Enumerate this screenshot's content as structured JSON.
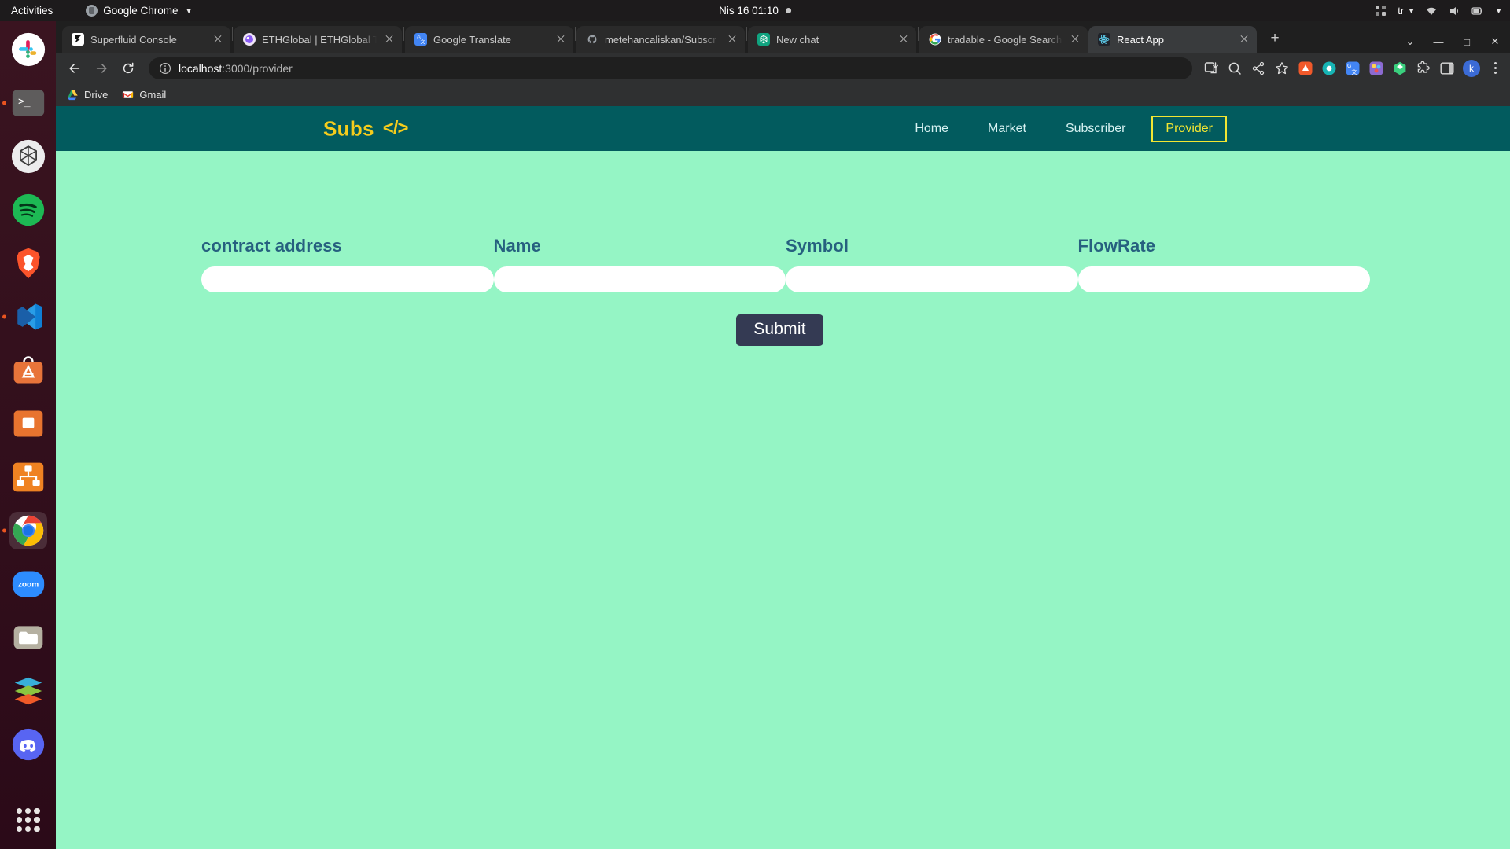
{
  "desktop": {
    "activities_label": "Activities",
    "active_app": "Google Chrome",
    "clock": "Nis 16  01:10",
    "keyboard_layout": "tr"
  },
  "dock": {
    "items": [
      {
        "name": "slack",
        "label": "Slack",
        "running": false
      },
      {
        "name": "terminal",
        "label": "Terminal",
        "running": true
      },
      {
        "name": "chatgpt",
        "label": "ChatGPT",
        "running": false
      },
      {
        "name": "spotify",
        "label": "Spotify",
        "running": false
      },
      {
        "name": "brave",
        "label": "Brave Browser",
        "running": false
      },
      {
        "name": "vscode",
        "label": "Visual Studio Code",
        "running": true
      },
      {
        "name": "ubuntu-software",
        "label": "Ubuntu Software",
        "running": false
      },
      {
        "name": "gimp",
        "label": "GIMP",
        "running": false
      },
      {
        "name": "remmina",
        "label": "Remmina",
        "running": false
      },
      {
        "name": "google-chrome",
        "label": "Google Chrome",
        "running": true
      },
      {
        "name": "zoom",
        "label": "Zoom",
        "running": false
      },
      {
        "name": "files",
        "label": "Files",
        "running": false
      },
      {
        "name": "layers",
        "label": "Layers",
        "running": false
      },
      {
        "name": "discord",
        "label": "Discord",
        "running": false
      }
    ],
    "show_apps_label": "Show Applications"
  },
  "browser": {
    "tabs": [
      {
        "title": "Superfluid Console",
        "favicon": "superfluid-icon",
        "active": false
      },
      {
        "title": "ETHGlobal | ETHGlobal T",
        "favicon": "ethglobal-icon",
        "active": false
      },
      {
        "title": "Google Translate",
        "favicon": "google-translate-icon",
        "active": false
      },
      {
        "title": "metehancaliskan/Subscr",
        "favicon": "github-icon",
        "active": false
      },
      {
        "title": "New chat",
        "favicon": "chatgpt-icon",
        "active": false
      },
      {
        "title": "tradable - Google Search",
        "favicon": "google-icon",
        "active": false
      },
      {
        "title": "React App",
        "favicon": "react-icon",
        "active": true
      }
    ],
    "new_tab_label": "+",
    "tab_search_label": "Search tabs",
    "window_controls": {
      "minimize": "—",
      "maximize": "□",
      "close": "✕"
    },
    "toolbar": {
      "back_label": "Back",
      "forward_label": "Forward",
      "reload_label": "Reload",
      "url_host": "localhost",
      "url_rest": ":3000/provider",
      "site_info_label": "View site information",
      "install_label": "Install",
      "zoom_label": "Zoom",
      "share_label": "Share this page",
      "bookmark_label": "Bookmark this tab",
      "extensions_label": "Extensions",
      "sidepanel_label": "Side panel",
      "profile_initial": "k",
      "menu_label": "Customize and control Google Chrome"
    },
    "bookmarks": [
      {
        "label": "Drive",
        "icon": "google-drive-icon"
      },
      {
        "label": "Gmail",
        "icon": "gmail-icon"
      }
    ]
  },
  "site": {
    "brand": {
      "name": "Subs",
      "code_glyph": "</>"
    },
    "nav": [
      {
        "label": "Home",
        "active": false
      },
      {
        "label": "Market",
        "active": false
      },
      {
        "label": "Subscriber",
        "active": false
      },
      {
        "label": "Provider",
        "active": true
      }
    ],
    "form": {
      "fields": [
        {
          "label": "contract address",
          "value": "",
          "placeholder": ""
        },
        {
          "label": "Name",
          "value": "",
          "placeholder": ""
        },
        {
          "label": "Symbol",
          "value": "",
          "placeholder": ""
        },
        {
          "label": "FlowRate",
          "value": "",
          "placeholder": ""
        }
      ],
      "submit_label": "Submit"
    }
  },
  "colors": {
    "page_bg": "#95f5c5",
    "nav_bg": "#025b5e",
    "brand": "#f5cc1c",
    "nav_active": "#f2e632",
    "label": "#26607f",
    "submit_bg": "#343a53"
  }
}
